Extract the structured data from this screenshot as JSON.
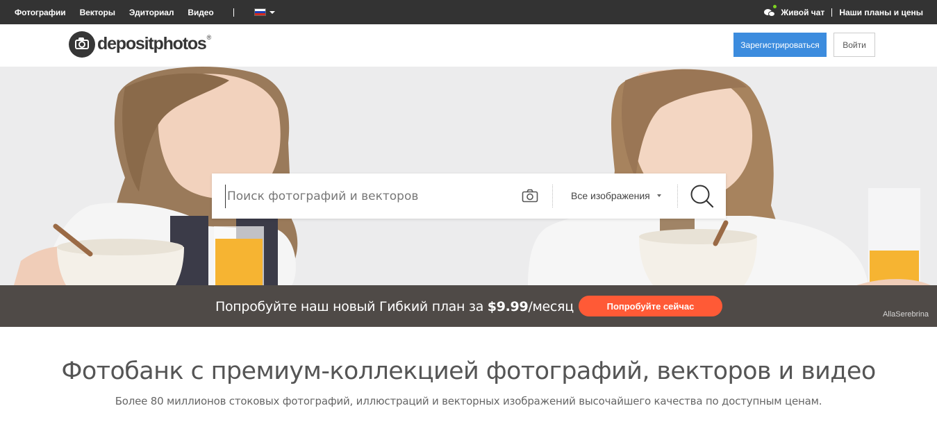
{
  "topbar": {
    "nav": [
      {
        "label": "Фотографии"
      },
      {
        "label": "Векторы"
      },
      {
        "label": "Эдиториал"
      },
      {
        "label": "Видео"
      }
    ],
    "live_chat": "Живой чат",
    "plans": "Наши планы и цены",
    "flag_colors": [
      "#ffffff",
      "#1c3fb7",
      "#d52b1e"
    ]
  },
  "header": {
    "logo_text": "depositphotos",
    "logo_reg": "®",
    "register_label": "Зарегистрироваться",
    "login_label": "Войти",
    "register_color": "#3c8cde"
  },
  "search": {
    "placeholder": "Поиск фотографий и векторов",
    "type_selected": "Все изображения",
    "camera_icon": "camera-icon",
    "search_icon": "search-icon"
  },
  "promo": {
    "text_before": "Попробуйте наш новый Гибкий план за ",
    "price": "$9.99",
    "text_after": "/месяц",
    "button_label": "Попробуйте сейчас",
    "button_color": "#ff5a36"
  },
  "hero": {
    "credit": "AllaSerebrina"
  },
  "main": {
    "title": "Фотобанк с премиум-коллекцией фотографий, векторов и видео",
    "subtitle": "Более 80 миллионов стоковых фотографий, иллюстраций и векторных изображений высочайшего качества по доступным ценам."
  }
}
